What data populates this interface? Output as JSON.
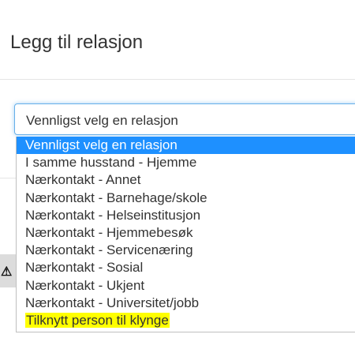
{
  "modal": {
    "title": "Legg til relasjon"
  },
  "relation_select": {
    "current_value": "Vennligst velg en relasjon",
    "options": [
      "Vennligst velg en relasjon",
      "I samme husstand - Hjemme",
      "Nærkontakt - Annet",
      "Nærkontakt - Barnehage/skole",
      "Nærkontakt - Helseinstitusjon",
      "Nærkontakt - Hjemmebesøk",
      "Nærkontakt - Servicenæring",
      "Nærkontakt - Sosial",
      "Nærkontakt - Ukjent",
      "Nærkontakt - Universitet/jobb",
      "Tilknytt person til klynge"
    ],
    "selected_index": 0,
    "highlighted_option_index": 10
  },
  "icons": {
    "warning": "warning-icon"
  },
  "colors": {
    "selected_option_bg": "#1e90ff",
    "highlight": "#ffff00",
    "focus_border": "#66afe9"
  }
}
